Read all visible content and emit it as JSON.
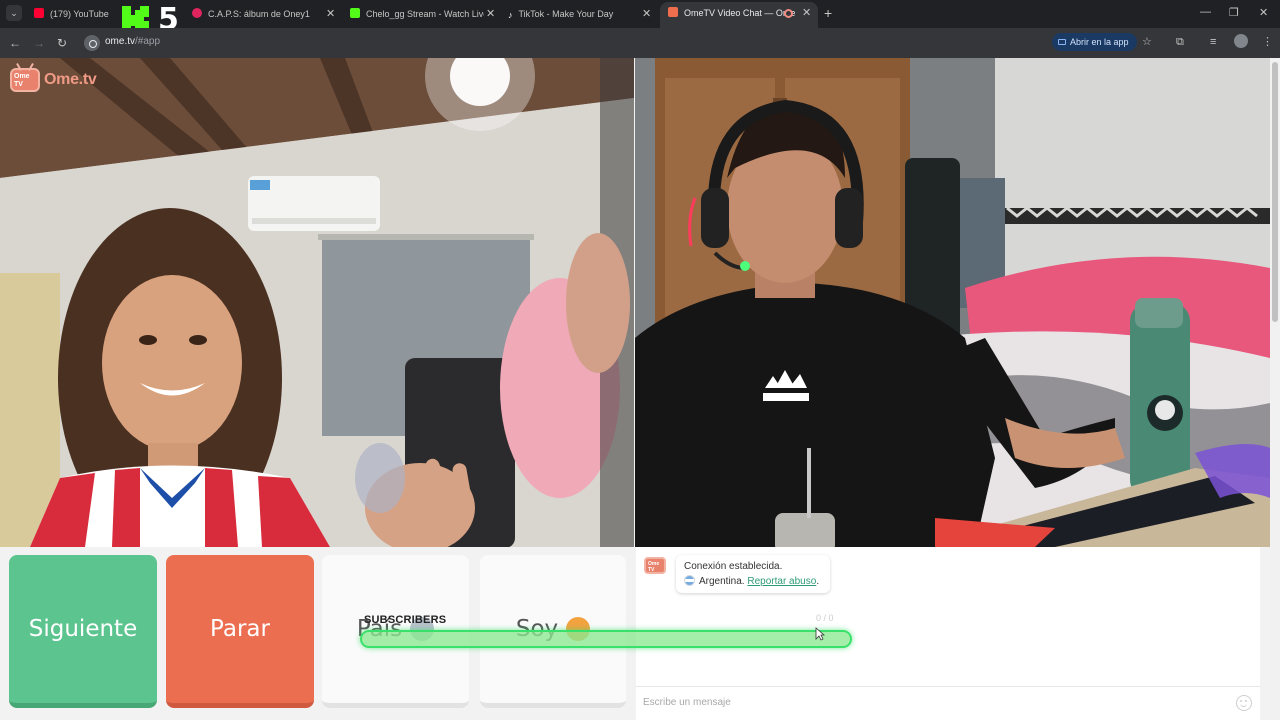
{
  "browser": {
    "tabs": [
      {
        "title": "(179) YouTube",
        "favicon_color": "#ff0033",
        "active": false
      },
      {
        "title": "C.A.P.S: álbum de Oney1",
        "favicon_color": "#e0245e",
        "active": false
      },
      {
        "title": "Chelo_gg Stream - Watch Live",
        "favicon_color": "#53fc18",
        "active": false
      },
      {
        "title": "TikTok - Make Your Day",
        "favicon_color": "#ffffff",
        "active": false
      },
      {
        "title": "OmeTV Video Chat — Ome",
        "favicon_color": "#ee6e4e",
        "active": true
      }
    ],
    "new_tab": "+",
    "url_host": "ome.tv",
    "url_path": "/#app",
    "open_in_app": "Abrir en la app"
  },
  "overlay": {
    "logo_digit": "5",
    "subscribers_label": "SUBSCRIBERS",
    "subscribers_progress": 1.0,
    "bar_color": "#39e06a"
  },
  "app": {
    "brand": "Ome.tv",
    "logo_badge": "Ome TV",
    "controls": {
      "next": "Siguiente",
      "stop": "Parar",
      "country": "País",
      "gender": "Soy"
    },
    "chat": {
      "status": "Conexión establecida.",
      "country": "Argentina.",
      "report": "Reportar abuso",
      "report_suffix": ".",
      "counter": "0 / 0",
      "placeholder": "Escribe un mensaje"
    },
    "colors": {
      "next": "#5cc48e",
      "stop": "#ec6e50",
      "brand": "#f09a86",
      "link": "#2f9a77"
    }
  }
}
